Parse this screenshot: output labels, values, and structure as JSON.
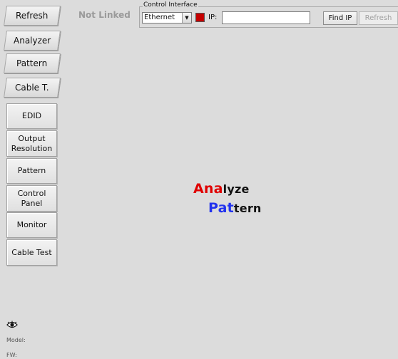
{
  "tab_buttons": [
    {
      "label": "Refresh"
    },
    {
      "label": "Analyzer"
    },
    {
      "label": "Pattern"
    },
    {
      "label": "Cable T."
    }
  ],
  "side_buttons": [
    {
      "label": "EDID"
    },
    {
      "label": "Output Resolution"
    },
    {
      "label": "Pattern"
    },
    {
      "label": "Control Panel"
    },
    {
      "label": "Monitor"
    },
    {
      "label": "Cable Test"
    }
  ],
  "status": {
    "link_text": "Not Linked"
  },
  "control_interface": {
    "title": "Control Interface",
    "connection_selected": "Ethernet",
    "ip_label": "IP:",
    "ip_value": "",
    "find_ip_label": "Find IP",
    "refresh_label": "Refresh",
    "status_color": "#c40000"
  },
  "logo": {
    "line1_highlight": "Ana",
    "line1_rest": "lyze",
    "line2_highlight": "Pat",
    "line2_rest": "tern",
    "line1_color": "#e00000",
    "line2_color": "#2233ee"
  },
  "footer": {
    "model_label": "Model:",
    "fw_label": "FW:",
    "eye_icon": "eye-icon"
  }
}
